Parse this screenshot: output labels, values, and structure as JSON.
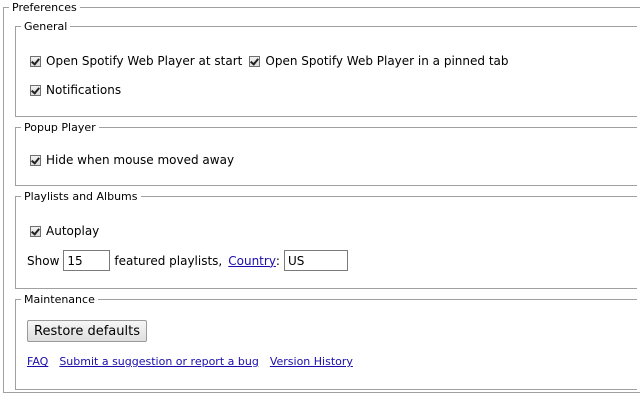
{
  "preferences": {
    "legend": "Preferences",
    "general": {
      "legend": "General",
      "open_at_start": "Open Spotify Web Player at start",
      "open_pinned_tab": "Open Spotify Web Player in a pinned tab",
      "notifications": "Notifications"
    },
    "popup_player": {
      "legend": "Popup Player",
      "hide_on_mouse_away": "Hide when mouse moved away"
    },
    "playlists_albums": {
      "legend": "Playlists and Albums",
      "autoplay": "Autoplay",
      "show_label": "Show",
      "featured_count": "15",
      "featured_label": "featured playlists,",
      "country_link": "Country",
      "country_colon": ":",
      "country_value": "US"
    },
    "maintenance": {
      "legend": "Maintenance",
      "restore_button": "Restore defaults",
      "links": {
        "faq": "FAQ",
        "suggestion": "Submit a suggestion or report a bug",
        "version_history": "Version History"
      }
    }
  },
  "colors": {
    "link": "#1a0dab",
    "border": "#a0a0a0"
  }
}
